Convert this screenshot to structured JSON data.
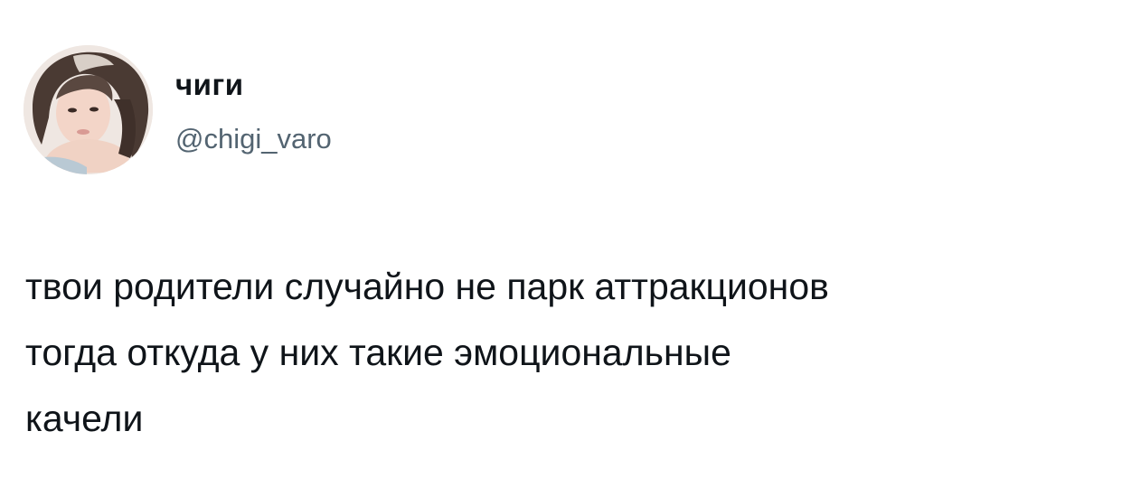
{
  "author": {
    "display_name": "чиги",
    "handle": "@chigi_varo",
    "avatar_icon": "profile-photo"
  },
  "tweet": {
    "lines": [
      "твои родители случайно не парк аттракционов",
      "тогда откуда у них такие эмоциональные",
      "качели"
    ]
  },
  "colors": {
    "background": "#ffffff",
    "text_primary": "#0f1419",
    "text_secondary": "#536471"
  }
}
